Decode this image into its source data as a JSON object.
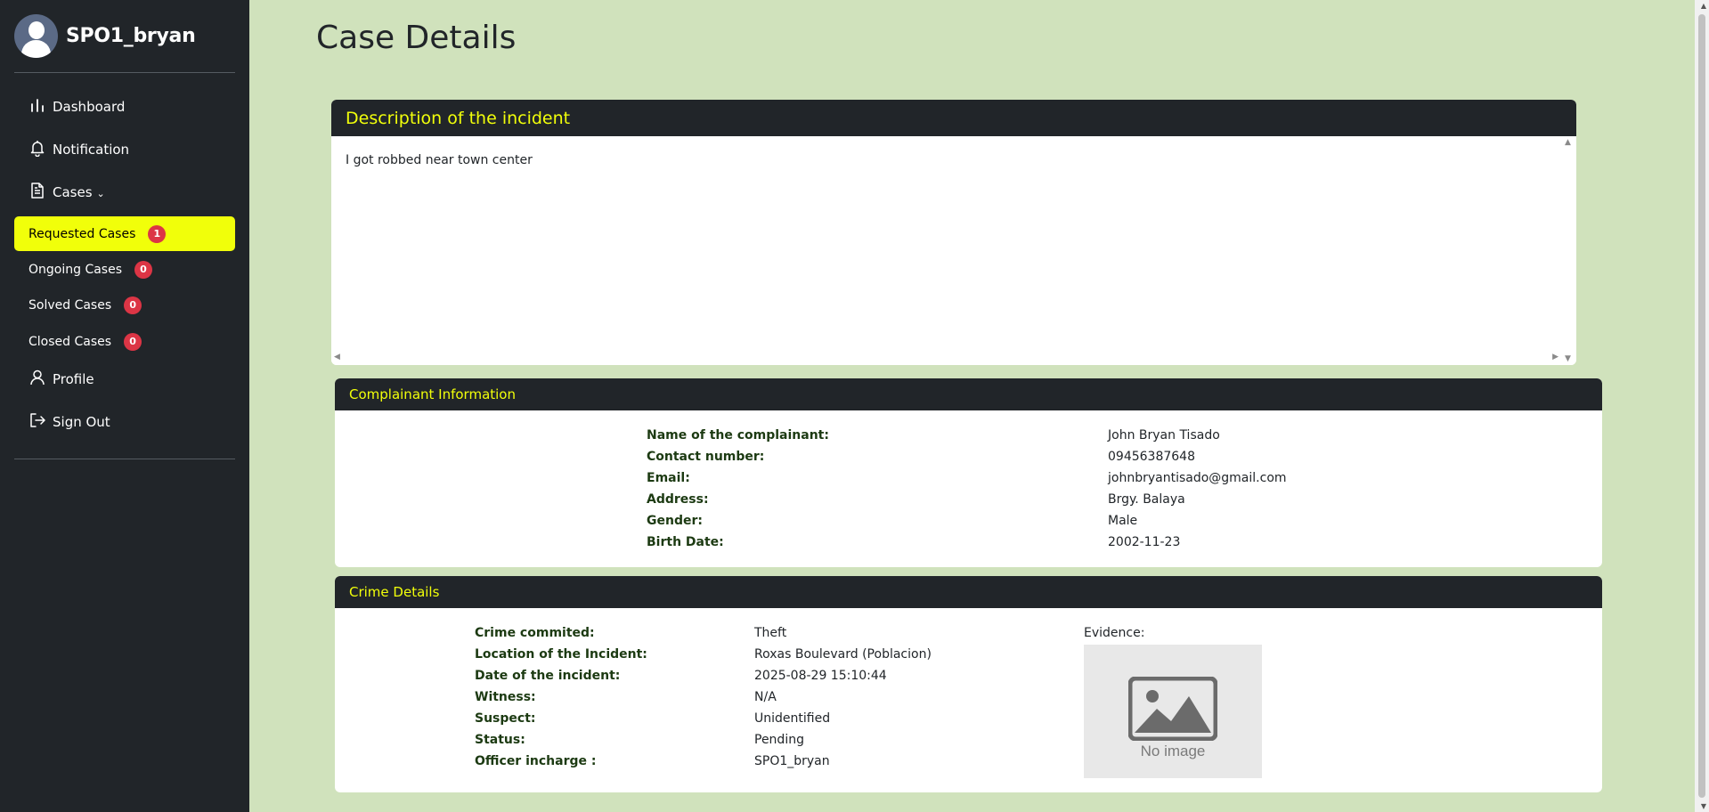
{
  "user": {
    "name": "SPO1_bryan"
  },
  "nav": {
    "dashboard": "Dashboard",
    "notification": "Notification",
    "cases": "Cases",
    "profile": "Profile",
    "sign_out": "Sign Out"
  },
  "cases_menu": [
    {
      "label": "Requested Cases",
      "count": "1",
      "active": true
    },
    {
      "label": "Ongoing Cases",
      "count": "0",
      "active": false
    },
    {
      "label": "Solved Cases",
      "count": "0",
      "active": false
    },
    {
      "label": "Closed Cases",
      "count": "0",
      "active": false
    }
  ],
  "page": {
    "title": "Case Details"
  },
  "description": {
    "header": "Description of the incident",
    "text": "I got robbed near town center"
  },
  "complainant": {
    "header": "Complainant Information",
    "fields": [
      {
        "label": "Name of the complainant:",
        "value": "John Bryan Tisado"
      },
      {
        "label": "Contact number:",
        "value": "09456387648"
      },
      {
        "label": "Email:",
        "value": "johnbryantisado@gmail.com"
      },
      {
        "label": "Address:",
        "value": "Brgy. Balaya"
      },
      {
        "label": "Gender:",
        "value": "Male"
      },
      {
        "label": "Birth Date:",
        "value": "2002-11-23"
      }
    ]
  },
  "crime": {
    "header": "Crime Details",
    "fields": [
      {
        "label": "Crime commited:",
        "value": "Theft"
      },
      {
        "label": "Location of the Incident:",
        "value": "Roxas Boulevard (Poblacion)"
      },
      {
        "label": "Date of the incident:",
        "value": "2025-08-29 15:10:44"
      },
      {
        "label": "Witness:",
        "value": "N/A"
      },
      {
        "label": "Suspect:",
        "value": "Unidentified"
      },
      {
        "label": "Status:",
        "value": "Pending"
      },
      {
        "label": "Officer incharge :",
        "value": "SPO1_bryan"
      }
    ],
    "evidence_label": "Evidence:",
    "evidence_placeholder": "No image"
  },
  "colors": {
    "sidebar": "#212529",
    "accent": "#f1ff0a",
    "page_bg": "#d0e2bc",
    "badge": "#dc3545"
  }
}
